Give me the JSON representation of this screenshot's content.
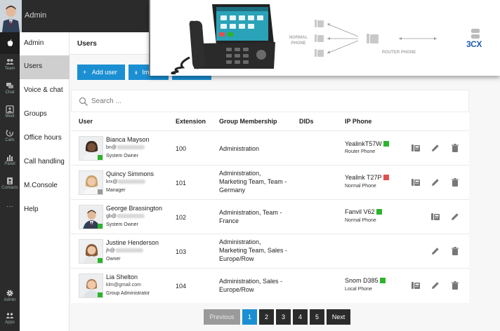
{
  "app": {
    "title": "Admin"
  },
  "rail": [
    {
      "icon": "users-icon",
      "label": "Team"
    },
    {
      "icon": "chat-icon",
      "label": "Chat"
    },
    {
      "icon": "meet-icon",
      "label": "Meet"
    },
    {
      "icon": "calls-icon",
      "label": "Calls"
    },
    {
      "icon": "panel-icon",
      "label": "Panel"
    },
    {
      "icon": "contacts-icon",
      "label": "Contacts"
    },
    {
      "icon": "more-icon",
      "label": "···"
    },
    {
      "icon": "gear-icon",
      "label": "Admin"
    },
    {
      "icon": "apps-icon",
      "label": "Apps"
    }
  ],
  "menu": {
    "items": [
      "Admin",
      "Users",
      "Voice & chat",
      "Groups",
      "Office hours",
      "Call handling",
      "M.Console",
      "Help"
    ],
    "active": "Users"
  },
  "main": {
    "title": "Users",
    "add_user": "Add user",
    "import": "Imp",
    "search_placeholder": "Search ..."
  },
  "table": {
    "headers": [
      "User",
      "Extension",
      "Group Membership",
      "DIDs",
      "IP Phone"
    ],
    "rows": [
      {
        "name": "Bianca Mayson",
        "email_prefix": "bn@",
        "email_domain": "",
        "role": "System Owner",
        "status_color": "#2db32d",
        "extension": "100",
        "groups": [
          "Administration"
        ],
        "phone_model": "YealinkT57W",
        "phone_status": "#2db32d",
        "phone_type": "Router Phone",
        "actions": [
          "phone-icon",
          "edit-icon",
          "delete-icon"
        ]
      },
      {
        "name": "Quincy Simmons",
        "email_prefix": "krx@",
        "email_domain": "",
        "role": "Manager",
        "status_color": "#9a9a9a",
        "extension": "101",
        "groups": [
          "Administration,",
          "Marketing Team, Team -",
          "Germany"
        ],
        "phone_model": "Yealink T27P",
        "phone_status": "#e05050",
        "phone_type": "Normal Phone",
        "actions": [
          "phone-icon",
          "edit-icon",
          "delete-icon"
        ]
      },
      {
        "name": "George Brassington",
        "email_prefix": "gb@",
        "email_domain": "",
        "role": "System Owner",
        "status_color": "#2db32d",
        "extension": "102",
        "groups": [
          "Administration, Team -",
          "France"
        ],
        "phone_model": "Fanvil V62",
        "phone_status": "#2db32d",
        "phone_type": "Normal Phone",
        "actions": [
          "phone-icon",
          "edit-icon"
        ]
      },
      {
        "name": "Justine Henderson",
        "email_prefix": "jh@",
        "email_domain": "",
        "role": "Owner",
        "status_color": "#2db32d",
        "extension": "103",
        "groups": [
          "Administration,",
          "Marketing Team, Sales -",
          "Europe/Row"
        ],
        "phone_model": "",
        "phone_status": "",
        "phone_type": "",
        "actions": [
          "edit-icon",
          "delete-icon"
        ]
      },
      {
        "name": "Lia Shelton",
        "email_prefix": "klm@gmail.com",
        "email_domain": "",
        "role": "Group Administrator",
        "status_color": "#2db32d",
        "extension": "104",
        "groups": [
          "Administration, Sales -",
          "Europe/Row"
        ],
        "phone_model": "Snom D385",
        "phone_status": "#2db32d",
        "phone_type": "Local Phone",
        "actions": [
          "phone-icon",
          "edit-icon",
          "delete-icon"
        ]
      }
    ]
  },
  "pagination": {
    "previous": "Previous",
    "pages": [
      "1",
      "2",
      "3",
      "4",
      "5"
    ],
    "next": "Next",
    "current": "1"
  },
  "banner": {
    "normal_phone": "NORMAL PHONE",
    "router_phone": "ROUTER PHONE",
    "logo": "3CX"
  },
  "colors": {
    "accent": "#1b8fd2",
    "online": "#2db32d",
    "busy": "#e05050",
    "offline": "#9a9a9a"
  }
}
